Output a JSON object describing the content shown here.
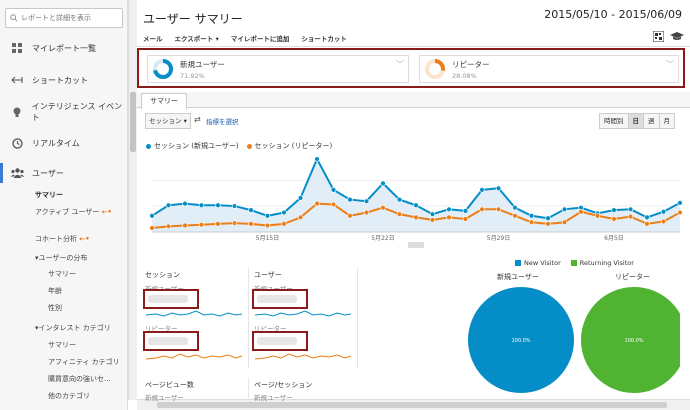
{
  "sidebar": {
    "search_placeholder": "レポートと詳細を表示",
    "items": [
      {
        "label": "マイレポート一覧",
        "icon": "grid-icon"
      },
      {
        "label": "ショートカット",
        "icon": "shortcut-arrow-icon"
      },
      {
        "label": "インテリジェンス イベント",
        "icon": "lightbulb-icon"
      },
      {
        "label": "リアルタイム",
        "icon": "clock-icon"
      },
      {
        "label": "ユーザー",
        "icon": "users-icon"
      }
    ],
    "users_sub": {
      "summary": "サマリー",
      "active_users": "アクティブ ユーザー",
      "cohort": "コホート分析",
      "distribution": "ユーザーの分布",
      "dist_items": [
        "サマリー",
        "年齢",
        "性別"
      ],
      "interest": "インタレスト カテゴリ",
      "interest_items": [
        "サマリー",
        "アフィニティ カテゴリ",
        "購買意向の強いセ...",
        "他のカテゴリ"
      ]
    }
  },
  "header": {
    "title": "ユーザー サマリー",
    "date_range": "2015/05/10 - 2015/06/09",
    "toolbar": [
      "メール",
      "エクスポート ▾",
      "マイレポートに追加",
      "ショートカット"
    ]
  },
  "segments": [
    {
      "name": "新規ユーザー",
      "percent": "71.92%",
      "color": "#058dc7"
    },
    {
      "name": "リピーター",
      "percent": "28.08%",
      "color": "#ed7e17"
    }
  ],
  "tabs": {
    "summary": "サマリー"
  },
  "controls": {
    "metric": "セッション",
    "vs_link": "指標を選択",
    "periods": [
      "時間別",
      "日",
      "週",
      "月"
    ],
    "active_period": "日"
  },
  "chart_data": {
    "type": "line",
    "x_labels": [
      "5月15日",
      "5月22日",
      "5月29日",
      "6月5日"
    ],
    "series": [
      {
        "name": "セッション (新規ユーザー)",
        "color": "#058dc7",
        "values": [
          20,
          33,
          35,
          33,
          33,
          32,
          27,
          20,
          24,
          42,
          90,
          52,
          40,
          38,
          60,
          40,
          33,
          22,
          28,
          26,
          52,
          54,
          30,
          20,
          17,
          28,
          30,
          23,
          27,
          28,
          18,
          25,
          36
        ]
      },
      {
        "name": "セッション (リピーター)",
        "color": "#ed7e17",
        "values": [
          5,
          7,
          8,
          9,
          10,
          11,
          10,
          8,
          10,
          18,
          35,
          34,
          20,
          24,
          30,
          22,
          18,
          15,
          18,
          16,
          28,
          28,
          20,
          12,
          10,
          12,
          25,
          20,
          16,
          19,
          10,
          13,
          24
        ]
      }
    ]
  },
  "metrics": [
    {
      "title": "セッション",
      "row1": "新規ユーザー",
      "row2": "リピーター"
    },
    {
      "title": "ユーザー",
      "row1": "新規ユーザー",
      "row2": "リピーター"
    },
    {
      "title": "ページビュー数",
      "row1": "新規ユーザー"
    },
    {
      "title": "ページ/セッション",
      "row1": "新規ユーザー"
    }
  ],
  "pie": {
    "legend": [
      {
        "label": "New Visitor",
        "color": "#058dc7"
      },
      {
        "label": "Returning Visitor",
        "color": "#50b432"
      }
    ],
    "charts": [
      {
        "title": "新規ユーザー",
        "color": "#058dc7",
        "label": "100.0%"
      },
      {
        "title": "リピーター",
        "color": "#50b432",
        "label": "100.0%"
      }
    ]
  }
}
